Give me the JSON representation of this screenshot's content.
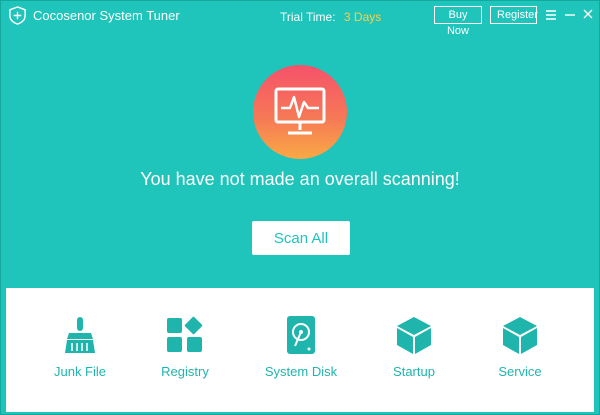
{
  "app": {
    "title": "Cocosenor System Tuner",
    "trial_label": "Trial Time:",
    "trial_days": "3 Days",
    "buy_label": "Buy Now",
    "register_label": "Register"
  },
  "main": {
    "status_text": "You have not made an overall scanning!",
    "scan_label": "Scan All"
  },
  "tools": [
    {
      "label": "Junk File",
      "icon": "broom-icon"
    },
    {
      "label": "Registry",
      "icon": "registry-grid-icon"
    },
    {
      "label": "System Disk",
      "icon": "hard-disk-icon"
    },
    {
      "label": "Startup",
      "icon": "cube-icon"
    },
    {
      "label": "Service",
      "icon": "cube-icon"
    }
  ],
  "colors": {
    "accent": "#1fc4ba",
    "trial_days": "#ffcf3f",
    "hero_gradient_top": "#f5526a",
    "hero_gradient_bottom": "#f9a945",
    "tool_icon": "#1fb5ad"
  }
}
